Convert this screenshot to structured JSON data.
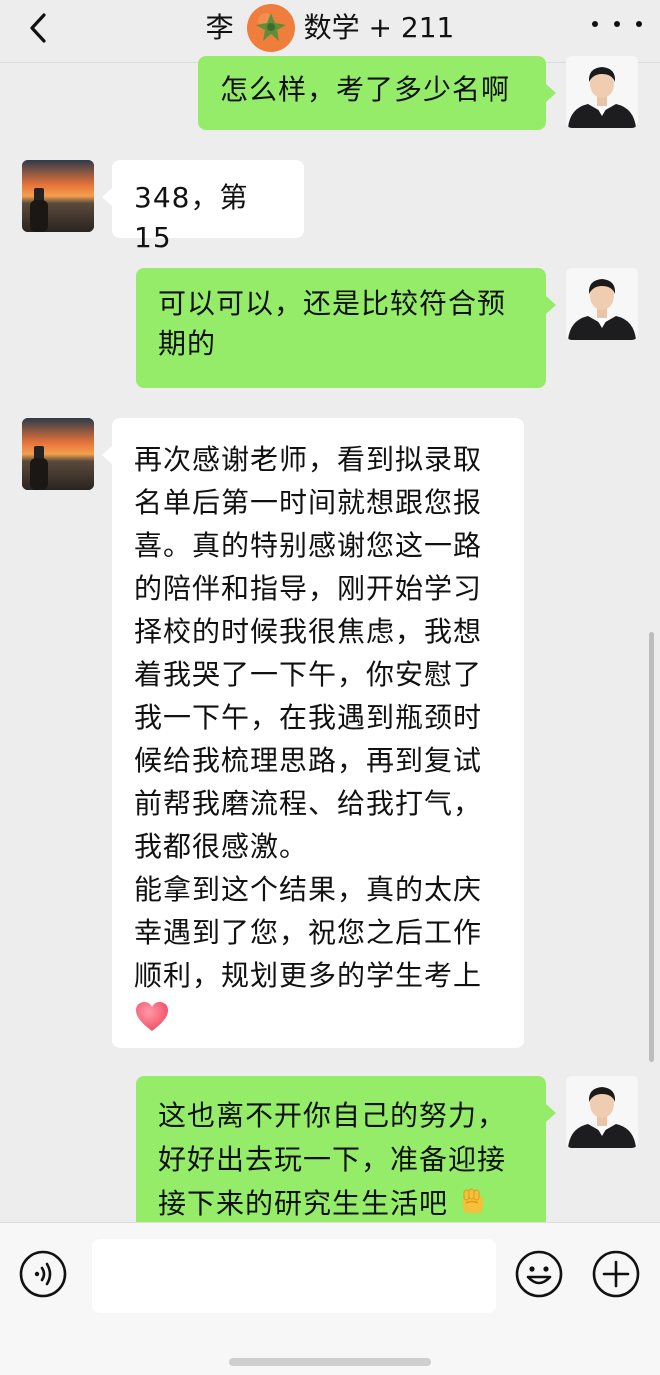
{
  "header": {
    "title_prefix": "李",
    "title_suffix": "数学 + 211",
    "back_icon": "chevron-left-icon",
    "more_icon": "more-dots-icon"
  },
  "messages": [
    {
      "sender": "me",
      "text": "怎么样，考了多少名啊"
    },
    {
      "sender": "other",
      "text": "348，第15"
    },
    {
      "sender": "me",
      "text": "可以可以，还是比较符合预\n期的"
    },
    {
      "sender": "other",
      "text": "再次感谢老师，看到拟录取\n名单后第一时间就想跟您报\n喜。真的特别感谢您这一路\n的陪伴和指导，刚开始学习\n择校的时候我很焦虑，我想\n着我哭了一下午，你安慰了\n我一下午，在我遇到瓶颈时\n候给我梳理思路，再到复试\n前帮我磨流程、给我打气，\n我都很感激。\n能拿到这个结果，真的太庆\n幸遇到了您，祝您之后工作\n顺利，规划更多的学生考上"
    },
    {
      "sender": "me",
      "text": "这也离不开你自己的努力，\n好好出去玩一下，准备迎接\n接下来的研究生生活吧"
    }
  ],
  "input_bar": {
    "text_value": "",
    "voice_icon": "voice-icon",
    "emoji_icon": "emoji-icon",
    "plus_icon": "plus-icon"
  },
  "colors": {
    "bubble_me": "#95ec69",
    "bubble_other": "#ffffff",
    "background": "#ededed"
  }
}
